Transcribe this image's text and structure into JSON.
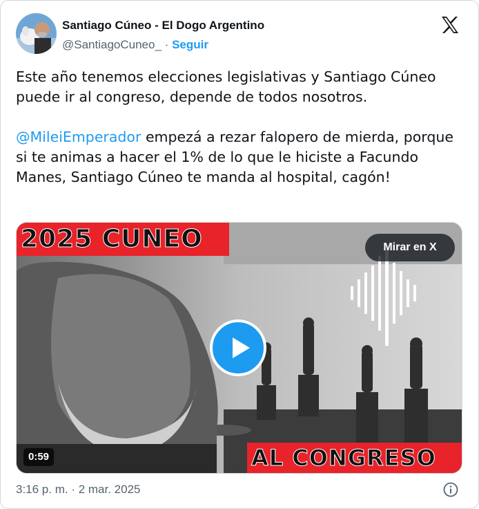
{
  "author": {
    "name": "Santiago Cúneo - El Dogo Argentino",
    "handle": "@SantiagoCuneo_",
    "separator": "·",
    "follow_label": "Seguir"
  },
  "tweet": {
    "paragraph1": "Este año tenemos elecciones legislativas y Santiago Cúneo puede ir al congreso, depende de todos nosotros.",
    "mention": "@MileiEmperador",
    "paragraph2_rest": " empezá a rezar falopero de mierda, porque si te animas a hacer el 1% de lo que le hiciste a Facundo Manes, Santiago Cúneo te manda al hospital, cagón!"
  },
  "media": {
    "banner_top": "2025 CUNEO",
    "banner_bottom": "AL CONGRESO",
    "watch_label": "Mirar en X",
    "duration": "0:59"
  },
  "footer": {
    "timestamp": "3:16 p. m. · 2 mar. 2025"
  },
  "icons": {
    "brand": "x-logo-icon",
    "play": "play-icon",
    "info": "info-icon",
    "audio": "audio-wave-icon"
  },
  "colors": {
    "link": "#1d9bf0",
    "banner": "#e8232a",
    "text": "#0f1419",
    "muted": "#536471"
  }
}
